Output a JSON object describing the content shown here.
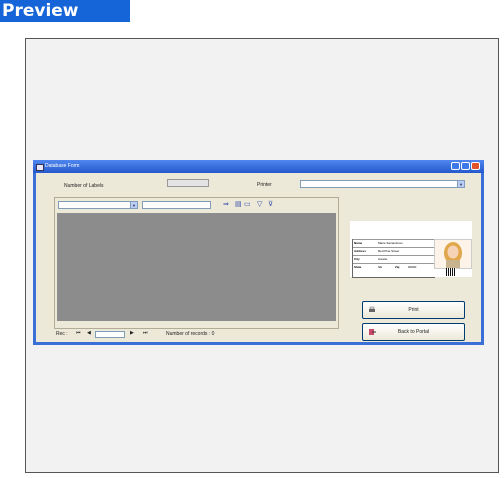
{
  "preview": {
    "title": "Preview"
  },
  "window": {
    "title": "Database Form",
    "number_of_labels_label": "Number of Labels",
    "printer_label": "Printer",
    "printer_value": "",
    "number_of_labels_value": ""
  },
  "toolbar": {
    "field_select_value": "",
    "search_value": ""
  },
  "nav": {
    "rec_label": "Rec :",
    "rec_value": "",
    "records_label": "Number of records : 0"
  },
  "card": {
    "rows": [
      {
        "key": "Name",
        "value": "Marie Samantman"
      },
      {
        "key": "Address",
        "value": "Red Pine Street"
      },
      {
        "key": "City",
        "value": "Aurelie"
      },
      {
        "key": "State",
        "value": "NE"
      }
    ],
    "zip_label": "Zip",
    "zip_value": "00000"
  },
  "buttons": {
    "print_label": "Print",
    "back_label": "Back to Portal"
  }
}
